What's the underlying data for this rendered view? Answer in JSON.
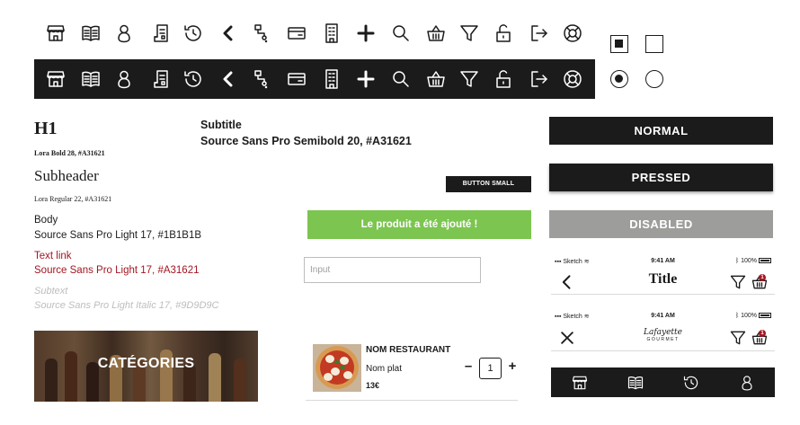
{
  "icons": [
    "store-icon",
    "menu-book-icon",
    "user-icon",
    "receipt-icon",
    "history-icon",
    "back-chevron-icon",
    "flow-icon",
    "card-icon",
    "building-icon",
    "plus-icon",
    "search-icon",
    "basket-icon",
    "filter-icon",
    "unlock-icon",
    "logout-icon",
    "help-lifebuoy-icon"
  ],
  "controls": {
    "checkbox_checked": true,
    "checkbox_unchecked": false,
    "radio_selected": true,
    "radio_unselected": false
  },
  "typography": {
    "h1": "H1",
    "h1_desc": "Lora Bold 28, #A31621",
    "subheader": "Subheader",
    "subheader_desc": "Lora Regular 22, #A31621",
    "body": "Body",
    "body_desc": "Source Sans Pro Light 17, #1B1B1B",
    "link": "Text link",
    "link_desc": "Source Sans Pro Light 17, #A31621",
    "subtext": "Subtext",
    "subtext_desc": "Source Sans Pro Light Italic 17, #9D9D9C",
    "subtitle": "Subtitle",
    "subtitle_desc": "Source Sans Pro Semibold 20, #A31621"
  },
  "buttons": {
    "small": "BUTTON SMALL",
    "normal": "NORMAL",
    "pressed": "PRESSED",
    "disabled": "DISABLED"
  },
  "toast": "Le produit a été ajouté !",
  "input": {
    "placeholder": "Input"
  },
  "status_bar": {
    "carrier": "Sketch",
    "time": "9:41 AM",
    "battery": "100%"
  },
  "nav": {
    "title": "Title",
    "brand_line1": "Lafayette",
    "brand_line2": "GOURMET",
    "badge_count": "1"
  },
  "tabbar_icons": [
    "store-icon",
    "menu-book-icon",
    "history-icon",
    "user-icon"
  ],
  "category": {
    "label": "CATÉGORIES"
  },
  "cart_item": {
    "restaurant": "NOM RESTAURANT",
    "dish": "Nom plat",
    "price": "13€",
    "quantity": "1",
    "minus": "–",
    "plus": "+"
  },
  "colors": {
    "primary_dark": "#1B1B1B",
    "brand_red": "#A31621",
    "success_green": "#7CC550",
    "disabled_gray": "#9D9D9C"
  }
}
